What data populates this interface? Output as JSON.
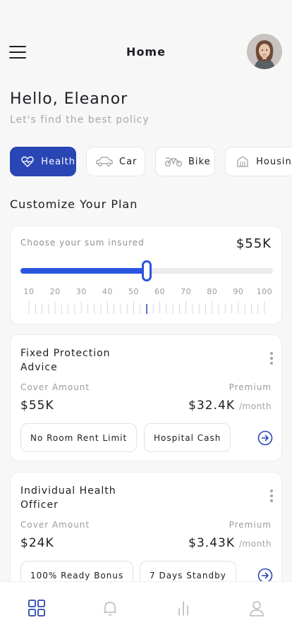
{
  "header": {
    "title": "Home"
  },
  "greeting": {
    "title": "Hello, Eleanor",
    "subtitle": "Let's find the best policy"
  },
  "categories": [
    {
      "label": "Health",
      "icon": "heart-pulse-icon",
      "active": true
    },
    {
      "label": "Car",
      "icon": "car-icon",
      "active": false
    },
    {
      "label": "Bike",
      "icon": "bike-icon",
      "active": false
    },
    {
      "label": "Housing",
      "icon": "building-icon",
      "active": false
    }
  ],
  "section_title": "Customize Your Plan",
  "sum_insured": {
    "label": "Choose your sum insured",
    "value": "$55K",
    "slider_level": 55,
    "scale": [
      "10",
      "20",
      "30",
      "40",
      "50",
      "60",
      "70",
      "80",
      "90",
      "100"
    ]
  },
  "plans": [
    {
      "name": "Fixed Protection Advice",
      "cover_label": "Cover Amount",
      "cover_value": "$55K",
      "premium_label": "Premium",
      "premium_value": "$32.4K",
      "premium_period": "/month",
      "tags": [
        "No Room Rent Limit",
        "Hospital Cash"
      ]
    },
    {
      "name": "Individual Health Officer",
      "cover_label": "Cover Amount",
      "cover_value": "$24K",
      "premium_label": "Premium",
      "premium_value": "$3.43K",
      "premium_period": "/month",
      "tags": [
        "100% Ready Bonus",
        "7 Days Standby"
      ]
    }
  ],
  "tabbar": [
    "grid-icon",
    "bell-icon",
    "chart-icon",
    "user-icon"
  ],
  "colors": {
    "accent": "#2a46b4",
    "slider": "#2a55e0",
    "background": "#f7f7f8"
  }
}
